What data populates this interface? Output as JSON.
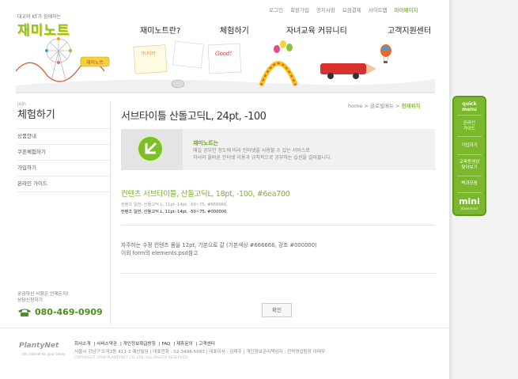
{
  "header": {
    "tagline": "대교와 KT가 함께하는",
    "logo": "재미노트",
    "top_menu": [
      {
        "label": "로그인"
      },
      {
        "label": "회원가입"
      },
      {
        "label": "공지사항"
      },
      {
        "label": "요금결제"
      },
      {
        "label": "사이트맵"
      },
      {
        "label": "마이페이지"
      }
    ],
    "gnb": [
      {
        "label": "재미노트란?"
      },
      {
        "label": "체험하기"
      },
      {
        "label": "자녀교육 커뮤니티"
      },
      {
        "label": "고객지원센터"
      }
    ],
    "banner_signs": {
      "sign1": "재미노트",
      "sign2": "가나다라",
      "sign3": "Good!"
    }
  },
  "sidebar": {
    "section_en": "join",
    "section_title": "체험하기",
    "items": [
      {
        "label": "상품안내"
      },
      {
        "label": "쿠폰체험하기"
      },
      {
        "label": "가입하기"
      },
      {
        "label": "온라인 가이드"
      }
    ],
    "cs_line1": "궁금하신 사항은 언제든지!",
    "cs_line2": "상담신청하기",
    "cs_phone": "080-469-0909"
  },
  "content": {
    "breadcrumb": {
      "home": "home",
      "sep": ">",
      "level1": "글로벌메뉴",
      "current": "현재위치"
    },
    "subtitle": "서브타이틀 산돌고딕L, 24pt, -100",
    "info_title": "재미노트는",
    "info_line1": "매일 공부한 정도에 따라 인터넷을 사용할 수 있는 서비스로",
    "info_line2": "자녀의 올바른 인터넷 이용과 규칙적으로 공부하는 습관을 길러줍니다.",
    "contents_title": "컨텐츠 서브타이틀, 산돌고딕L, 18pt, -100, #6ea700",
    "small_line1": "컨텐츠 일반, 산돌고딕 L, 11pt- 14pt, -50~75, #666666,",
    "small_line2": "컨텐츠 일반, 산돌고딕 L, 11pt- 14pt, -50~75, #000000,",
    "body_line1": "자주하는 수정 컨텐츠 몸을 12pt, 기본으로 갈 (기본색상 #666666, 강조 #000000)",
    "body_line2": "이외 form의 elements.psd참고",
    "confirm_label": "확인"
  },
  "footer": {
    "logo": "PlantyNet",
    "logo_sub": "the internet for your family",
    "menu": [
      {
        "label": "회사소개"
      },
      {
        "label": "서비스약관"
      },
      {
        "label": "개인정보취급방침"
      },
      {
        "label": "FAQ"
      },
      {
        "label": "제휴문의"
      },
      {
        "label": "고객센터"
      }
    ],
    "address": "서울시 강남구 도곡2동 411-3 예산빌딩 | 대표전화 : 02-3498-5093 | 대표이사 : 김태주 | 개인정보관리책임자 : 전략영업팀장 이태우",
    "copyright": "COPYRIGHT 2006 PLANTYNET CO.,LTD. ALL RIGHTS RESERVED"
  },
  "quick_menu": {
    "head1": "quick",
    "head2": "menu",
    "items": [
      {
        "line1": "온라인",
        "line2": "가이드"
      },
      {
        "line1": "가입하기",
        "line2": ""
      },
      {
        "line1": "교육동영상",
        "line2": "찾아보기"
      },
      {
        "line1": "벽과모음",
        "line2": ""
      }
    ],
    "mini": "mini",
    "download": "download"
  },
  "colors": {
    "brand_green": "#8ac23a",
    "contents_green": "#6ea700",
    "quick_green": "#7cb82d"
  }
}
